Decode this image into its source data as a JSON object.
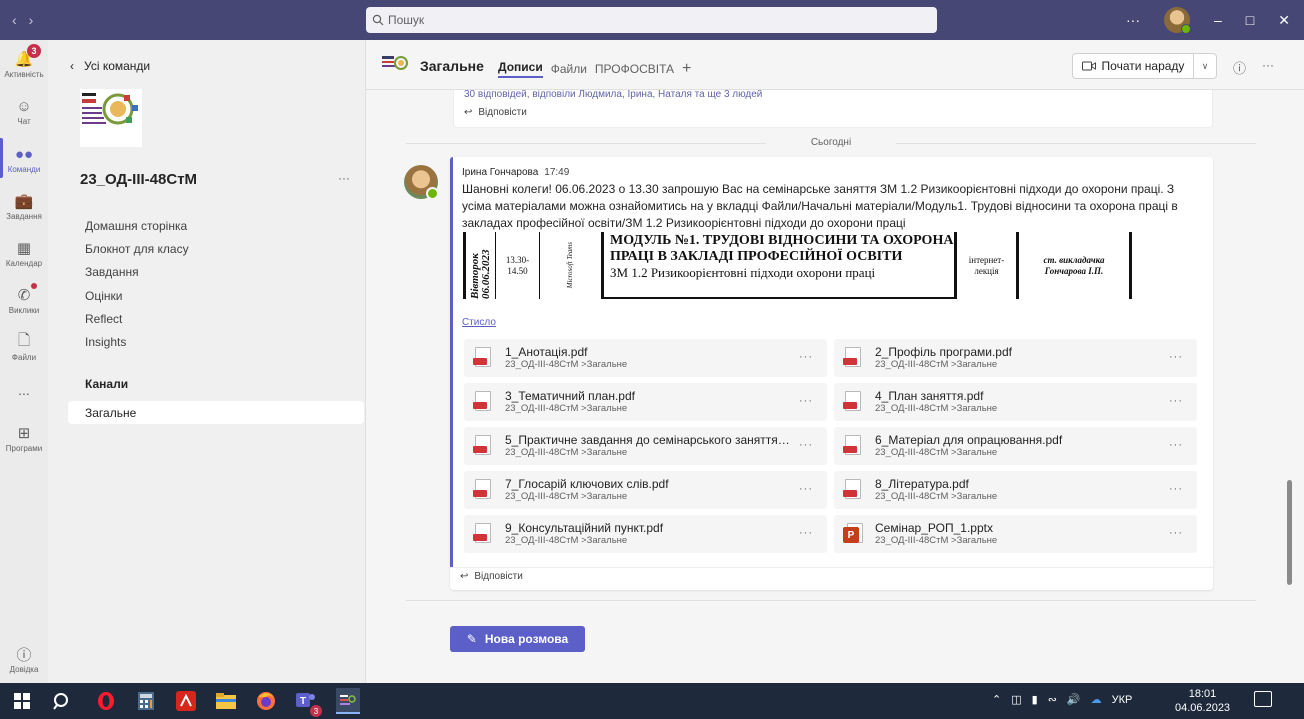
{
  "search": {
    "placeholder": "Пошук"
  },
  "rail": {
    "activity": {
      "label": "Активність",
      "badge": "3"
    },
    "chat": {
      "label": "Чат"
    },
    "teams": {
      "label": "Команди"
    },
    "assignments": {
      "label": "Завдання"
    },
    "calendar": {
      "label": "Календар"
    },
    "calls": {
      "label": "Виклики"
    },
    "files": {
      "label": "Файли"
    },
    "more": {
      "label": "..."
    },
    "apps": {
      "label": "Програми"
    },
    "help": {
      "label": "Довідка"
    }
  },
  "panel": {
    "back_label": "Усі команди",
    "team_name": "23_ОД-ІІІ-48СтМ",
    "logo_text": "2023 КЛК ПРОФЕСІЙНА (ПРОФЕСІЙНО ТЕХНІЧНА) ОСВІТА",
    "nav": [
      "Домашня сторінка",
      "Блокнот для класу",
      "Завдання",
      "Оцінки",
      "Reflect",
      "Insights"
    ],
    "channels_heading": "Канали",
    "selected_channel": "Загальне"
  },
  "header": {
    "title": "Загальне",
    "tabs": [
      "Дописи",
      "Файли",
      "ПРОФОСВІТА"
    ],
    "meet_label": "Почати нараду"
  },
  "conversation": {
    "prev_replies": "30 відповідей, відповіли Людмила, Ірина, Наталя та ще 3 людей",
    "reply_label": "Відповісти",
    "today_label": "Сьогодні",
    "message": {
      "author": "Ірина Гончарова",
      "time": "17:49",
      "text": "Шановні колеги! 06.06.2023 о 13.30 запрошую Вас  на семінарське заняття ЗМ 1.2 Ризикоорієнтовні підходи до охорони праці. З усіма матеріалами можна ознайомитись на у вкладці Файли/Начальні матеріали/Модуль1. Трудові відносини та охорона праці в закладах професійної освіти/ЗМ 1.2 Ризикоорієнтовні підходи до охорони праці",
      "timetable": {
        "day": "Вівторок 06.06.2023",
        "time": "13.30-14.50",
        "platform": "Microsoft Teams",
        "module_title": "МОДУЛЬ №1. ТРУДОВІ ВІДНОСИНИ ТА ОХОРОНА ПРАЦІ В ЗАКЛАДІ ПРОФЕСІЙНОЇ ОСВІТИ",
        "topic": "ЗМ 1.2 Ризикоорієнтовні підходи охорони праці",
        "format": "інтернет-лекція",
        "teacher": "ст. викладачка Гончарова І.П."
      },
      "collapse_label": "Стисло",
      "files": [
        {
          "name": "1_Анотація.pdf",
          "path": "23_ОД-ІІІ-48СтМ >Загальне",
          "type": "pdf"
        },
        {
          "name": "2_Профіль програми.pdf",
          "path": "23_ОД-ІІІ-48СтМ >Загальне",
          "type": "pdf"
        },
        {
          "name": "3_Тематичний план.pdf",
          "path": "23_ОД-ІІІ-48СтМ >Загальне",
          "type": "pdf"
        },
        {
          "name": "4_План заняття.pdf",
          "path": "23_ОД-ІІІ-48СтМ >Загальне",
          "type": "pdf"
        },
        {
          "name": "5_Практичне завдання до семінарського заняття....",
          "path": "23_ОД-ІІІ-48СтМ >Загальне",
          "type": "pdf"
        },
        {
          "name": "6_Матеріал для опрацювання.pdf",
          "path": "23_ОД-ІІІ-48СтМ >Загальне",
          "type": "pdf"
        },
        {
          "name": "7_Глосарій ключових слів.pdf",
          "path": "23_ОД-ІІІ-48СтМ >Загальне",
          "type": "pdf"
        },
        {
          "name": "8_Література.pdf",
          "path": "23_ОД-ІІІ-48СтМ >Загальне",
          "type": "pdf"
        },
        {
          "name": "9_Консультаційний пункт.pdf",
          "path": "23_ОД-ІІІ-48СтМ >Загальне",
          "type": "pdf"
        },
        {
          "name": "Семінар_РОП_1.pptx",
          "path": "23_ОД-ІІІ-48СтМ >Загальне",
          "type": "pptx"
        }
      ]
    },
    "new_conversation_label": "Нова розмова"
  },
  "taskbar": {
    "teams_badge": "3",
    "language": "УКР",
    "time": "18:01",
    "date": "04.06.2023"
  },
  "colors": {
    "accent": "#5b5fc7",
    "titlebar": "#464775",
    "taskbar": "#1e2a3c",
    "badge": "#c4314b"
  }
}
